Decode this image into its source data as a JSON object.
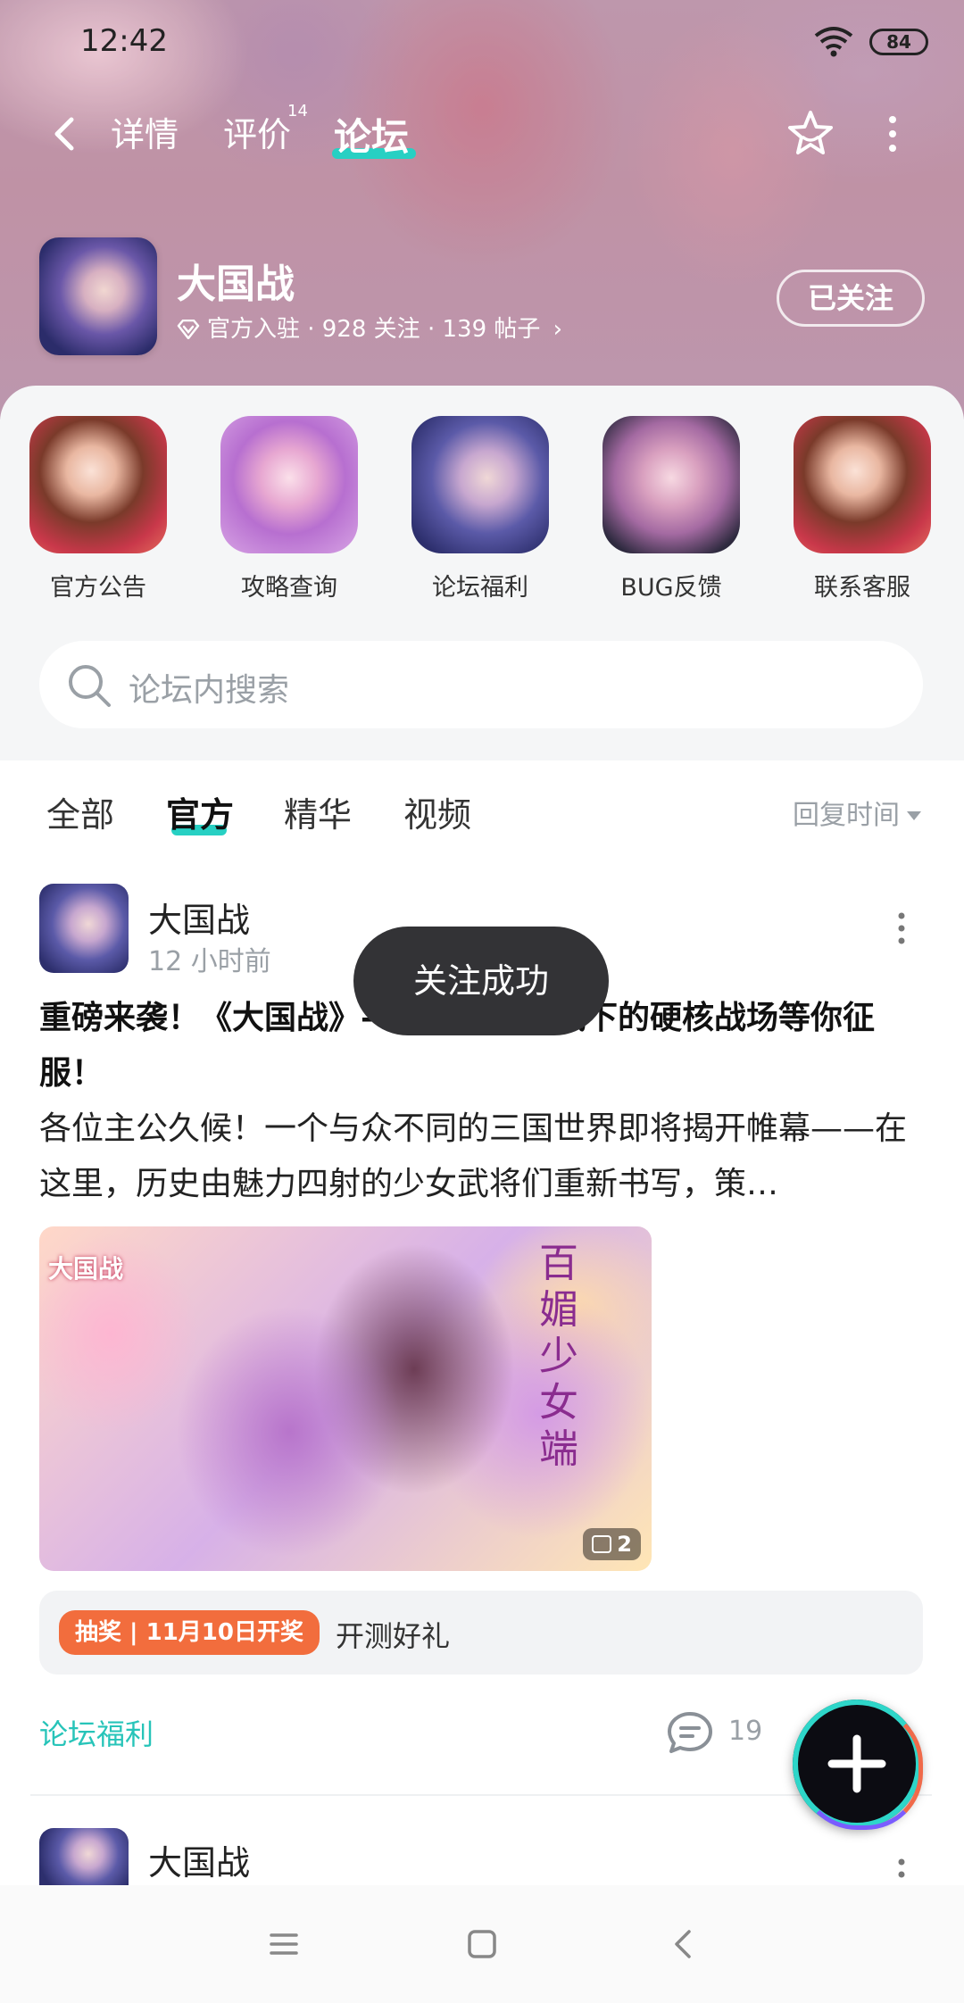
{
  "status": {
    "time": "12:42",
    "battery": "84"
  },
  "nav": {
    "tabs": [
      {
        "label": "详情"
      },
      {
        "label": "评价",
        "badge": "14"
      },
      {
        "label": "论坛"
      }
    ]
  },
  "game": {
    "name": "大国战",
    "meta": "官方入驻 · 928 关注 · 139 帖子",
    "follow_label": "已关注"
  },
  "shortcuts": [
    {
      "label": "官方公告"
    },
    {
      "label": "攻略查询"
    },
    {
      "label": "论坛福利"
    },
    {
      "label": "BUG反馈"
    },
    {
      "label": "联系客服"
    }
  ],
  "search": {
    "placeholder": "论坛内搜索"
  },
  "filters": {
    "tabs": [
      {
        "label": "全部"
      },
      {
        "label": "官方"
      },
      {
        "label": "精华"
      },
      {
        "label": "视频"
      }
    ],
    "sort_label": "回复时间"
  },
  "post": {
    "author": "大国战",
    "time": "12 小时前",
    "title": "重磅来袭！《大国战》——少女萌画风下的硬核战场等你征服！",
    "body": "各位主公久候！一个与众不同的三国世界即将揭开帷幕——在这里，历史由魅力四射的少女武将们重新书写，策…",
    "image_logo": "大国战",
    "image_calligraphy": "百媚少女端",
    "image_count": "2",
    "lottery_tag": "抽奖 | 11月10日开奖",
    "lottery_text": "开测好礼",
    "forum_tag": "论坛福利",
    "comments": "19"
  },
  "post2": {
    "author": "大国战"
  },
  "toast": "关注成功",
  "colors": {
    "accent": "#27d0c3",
    "lottery": "#f26d3d",
    "link": "#27c4b9"
  }
}
